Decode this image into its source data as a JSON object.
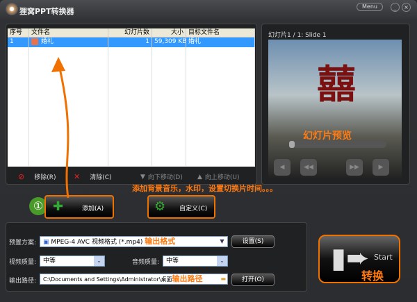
{
  "app": {
    "title": "狸窝PPT转换器",
    "menu": "Menu",
    "minimize": "_",
    "close": "×"
  },
  "list": {
    "headers": [
      "序号",
      "文件名",
      "幻灯片数",
      "大小",
      "目标文件名"
    ],
    "rows": [
      {
        "index": "1",
        "name": "婚礼",
        "slides": "1",
        "size": "59,309 KB",
        "target": "婚礼"
      }
    ]
  },
  "toolbar": {
    "remove": "移除(R)",
    "clear": "清除(C)",
    "down": "向下移动(D)",
    "up": "向上移动(U)"
  },
  "preview": {
    "label": "幻灯片1 / 1: Slide 1",
    "annotation": "幻灯片预览",
    "overlay": "囍"
  },
  "actions": {
    "step": "①",
    "add": "添加(A)",
    "custom": "自定义(C)",
    "custom_annotation": "添加背景音乐，水印，设置切换片时间。。。"
  },
  "settings": {
    "preset_label": "预置方案:",
    "preset_value": "MPEG-4 AVC 视频格式 (*.mp4)",
    "preset_annotation": "输出格式",
    "settings_btn": "设置(S)",
    "video_q_label": "视频质量:",
    "video_q": "中等",
    "audio_q_label": "音频质量:",
    "audio_q": "中等",
    "out_label": "输出路径:",
    "out_value": "C:\\Documents and Settings\\Administrator\\桌面",
    "out_annotation": "输出路径",
    "open_btn": "打开(O)"
  },
  "start": {
    "en": "Start",
    "cn": "转换"
  }
}
